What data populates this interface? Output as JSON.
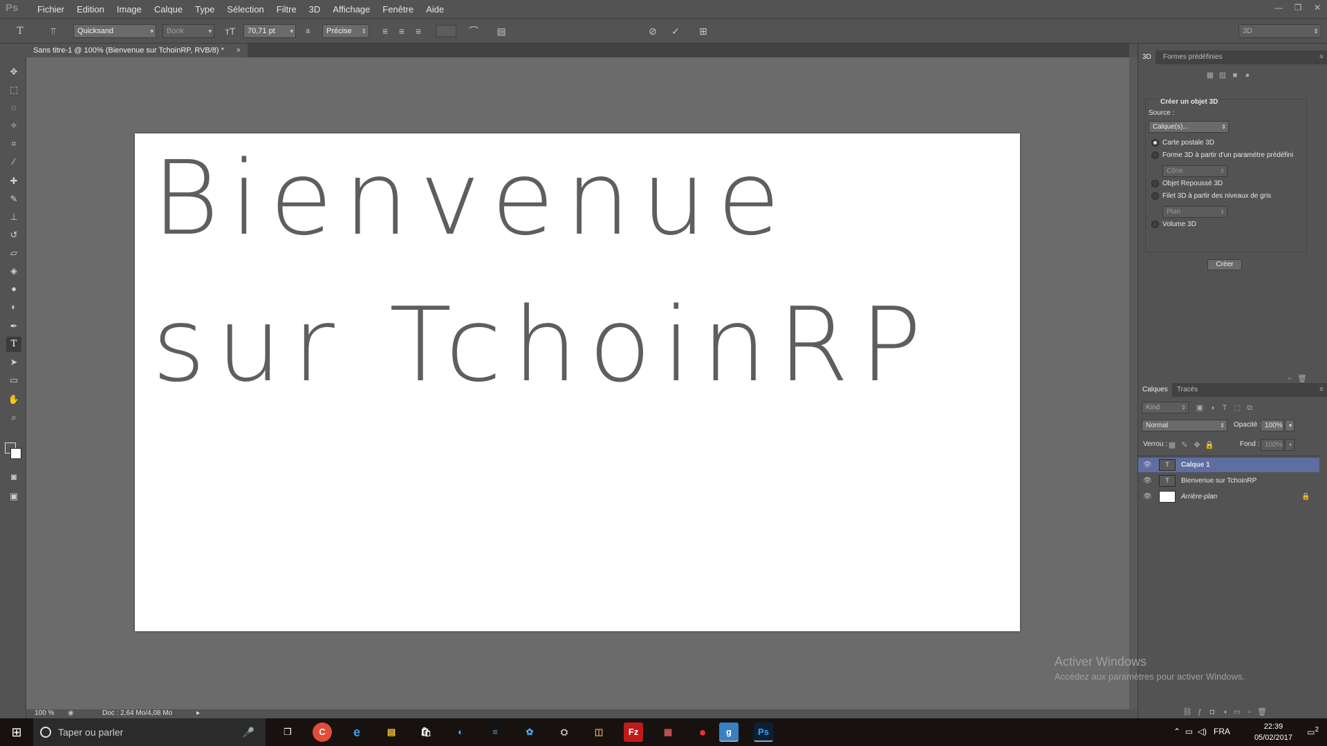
{
  "app": {
    "logo": "Ps"
  },
  "menubar": {
    "items": [
      "Fichier",
      "Edition",
      "Image",
      "Calque",
      "Type",
      "Sélection",
      "Filtre",
      "3D",
      "Affichage",
      "Fenêtre",
      "Aide"
    ]
  },
  "window_controls": [
    "—",
    "❐",
    "✕"
  ],
  "options_bar": {
    "font_family": "Quicksand",
    "font_style": "Book",
    "font_size": "70,71 pt",
    "aa_label": "a",
    "antialias": "Précise",
    "workspace": "3D"
  },
  "document_tab": {
    "title": "Sans titre-1 @ 100% (Bienvenue sur TchoinRP, RVB/8) *",
    "close": "×"
  },
  "canvas": {
    "line1": "Bienvenue",
    "line2": "sur TchoinRP"
  },
  "status": {
    "zoom": "100 %",
    "doc_info": "Doc : 2,64 Mo/4,08 Mo"
  },
  "panel3d": {
    "tabs": [
      "3D",
      "Formes prédéfinies"
    ],
    "group_title": "Créer un objet 3D",
    "source_label": "Source :",
    "source_value": "Calque(s)...",
    "options": [
      {
        "label": "Carte postale 3D",
        "checked": true
      },
      {
        "label": "Forme 3D à partir d'un paramètre prédéfini",
        "checked": false
      },
      {
        "label": "Objet Repoussé 3D",
        "checked": false
      },
      {
        "label": "Filet 3D à partir des niveaux de gris",
        "checked": false
      },
      {
        "label": "Volume 3D",
        "checked": false
      }
    ],
    "shape_select": "Cône",
    "mesh_select": "Plan",
    "create_button": "Créer"
  },
  "layers_panel": {
    "tabs": [
      "Calques",
      "Tracés"
    ],
    "filter_kind": "Kind",
    "blend_mode": "Normal",
    "opacity_label": "Opacité :",
    "opacity_value": "100%",
    "lock_label": "Verrou :",
    "fill_label": "Fond :",
    "fill_value": "100%",
    "layers": [
      {
        "name": "Calque 1",
        "thumb": "T",
        "selected": true
      },
      {
        "name": "Bienvenue sur TchoinRP",
        "thumb": "T",
        "selected": false
      },
      {
        "name": "Arrière-plan",
        "thumb": "",
        "selected": false,
        "locked": true
      }
    ]
  },
  "watermark": {
    "line1": "Activer Windows",
    "line2": "Accédez aux paramètres pour activer Windows."
  },
  "taskbar": {
    "search_placeholder": "Taper ou parler",
    "apps": [
      "C",
      "e",
      "▤",
      "🛍",
      "◐",
      "≡",
      "✿",
      "⛭",
      "◫",
      "Fz",
      "▦",
      "●",
      "g",
      "Ps"
    ],
    "lang": "FRA",
    "time": "22:39",
    "date": "05/02/2017",
    "notif": "2"
  },
  "colors": {
    "accent_selected_layer": "#5e6ea0",
    "ps_blue": "#31a8ff"
  }
}
